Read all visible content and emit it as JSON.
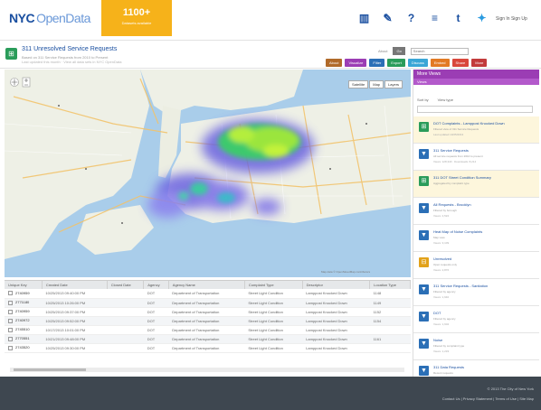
{
  "header": {
    "logo_nyc": "NYC",
    "logo_od": "OpenData",
    "promo_big": "1100+",
    "promo_small": "Datasets available",
    "signin": "Sign In  Sign Up"
  },
  "dataset": {
    "title": "311 Unresolved Service Requests",
    "sub1": "Based on 311 Service Requests from 2010 to Present",
    "sub2": "Last updated this month · View all data sets in NYC OpenData",
    "search_link": "About",
    "go_label": "Go",
    "search_placeholder": "Search",
    "actions": [
      {
        "label": "About",
        "color": "#b06a2a"
      },
      {
        "label": "Visualize",
        "color": "#9b3db4"
      },
      {
        "label": "Filter",
        "color": "#2b6fb6"
      },
      {
        "label": "Export",
        "color": "#2a9c5a"
      },
      {
        "label": "Discuss",
        "color": "#3aa6d6"
      },
      {
        "label": "Embed",
        "color": "#e27a24"
      },
      {
        "label": "Share",
        "color": "#d9473b"
      },
      {
        "label": "More",
        "color": "#c23b3b"
      }
    ]
  },
  "map": {
    "buttons": [
      "Satellite",
      "Map",
      "Layers"
    ],
    "attribution": "Map data © OpenStreetMap contributors"
  },
  "table": {
    "columns": [
      "Unique Key",
      "Created Date",
      "Closed Date",
      "Agency",
      "Agency Name",
      "Complaint Type",
      "Descriptor",
      "Location Type"
    ],
    "rows": [
      [
        "2740959",
        "10/25/2013 09:40:00 PM",
        "DOT",
        "Department of Transportation",
        "Street Light Condition",
        "Lamppost Knocked Down",
        "1148"
      ],
      [
        "2771180",
        "10/25/2013 10:26:00 PM",
        "DOT",
        "Department of Transportation",
        "Street Light Condition",
        "Lamppost Knocked Down",
        "1149"
      ],
      [
        "2740959",
        "10/25/2013 09:37:00 PM",
        "DOT",
        "Department of Transportation",
        "Street Light Condition",
        "Lamppost Knocked Down",
        "1152"
      ],
      [
        "2740972",
        "10/25/2013 09:52:00 PM",
        "DOT",
        "Department of Transportation",
        "Street Light Condition",
        "Lamppost Knocked Down",
        "1154"
      ],
      [
        "2745510",
        "10/17/2013 10:01:00 PM",
        "DOT",
        "Department of Transportation",
        "Street Light Condition",
        "Lamppost Knocked Down",
        ""
      ],
      [
        "2770551",
        "10/21/2013 09:48:00 PM",
        "DOT",
        "Department of Transportation",
        "Street Light Condition",
        "Lamppost Knocked Down",
        "1161"
      ],
      [
        "2743520",
        "10/25/2013 09:30:00 PM",
        "DOT",
        "Department of Transportation",
        "Street Light Condition",
        "Lamppost Knocked Down",
        ""
      ]
    ]
  },
  "panel": {
    "header": "More Views",
    "subheader": "Views",
    "sort_label": "Sort by",
    "view_type_label": "View type",
    "items": [
      {
        "title": "DOT Complaints - Lamppost Knocked Down",
        "meta": "Filtered view of 311 Service Requests",
        "meta2": "Last updated 10/25/2013",
        "icon": "⊞",
        "color": "#2a9c5a",
        "highlight": true
      },
      {
        "title": "311 Service Requests",
        "meta": "All service requests from 2010 to present",
        "meta2": "Views: 128,340 · Downloads: 8,214",
        "icon": "▼",
        "color": "#2b6fb6",
        "highlight": false
      },
      {
        "title": "311 DOT Street Condition Summary",
        "meta": "Aggregated by complaint type",
        "meta2": "",
        "icon": "⊞",
        "color": "#2a9c5a",
        "highlight": true
      },
      {
        "title": "All Requests - Brooklyn",
        "meta": "Filtered by borough",
        "meta2": "Views: 4,522",
        "icon": "▼",
        "color": "#2b6fb6",
        "highlight": false
      },
      {
        "title": "Heat Map of Noise Complaints",
        "meta": "Map view",
        "meta2": "Views: 3,109",
        "icon": "▼",
        "color": "#2b6fb6",
        "highlight": false
      },
      {
        "title": "Unresolved",
        "meta": "Open requests only",
        "meta2": "Views: 2,876",
        "icon": "⊟",
        "color": "#e2a21a",
        "highlight": false
      },
      {
        "title": "311 Service Requests - Sanitation",
        "meta": "Filtered by agency",
        "meta2": "Views: 1,940",
        "icon": "▼",
        "color": "#2b6fb6",
        "highlight": false
      },
      {
        "title": "DOT",
        "meta": "Filtered by agency",
        "meta2": "Views: 1,602",
        "icon": "▼",
        "color": "#2b6fb6",
        "highlight": false
      },
      {
        "title": "Noise",
        "meta": "Filtered by complaint type",
        "meta2": "Views: 1,233",
        "icon": "▼",
        "color": "#2b6fb6",
        "highlight": false
      },
      {
        "title": "311 Data Requests",
        "meta": "Recent requests",
        "meta2": "Views: 998",
        "icon": "▼",
        "color": "#2b6fb6",
        "highlight": false
      }
    ]
  },
  "footer": {
    "line1": "© 2013 The City of New York",
    "line2": "Contact Us | Privacy Statement | Terms of Use | Site Map"
  }
}
